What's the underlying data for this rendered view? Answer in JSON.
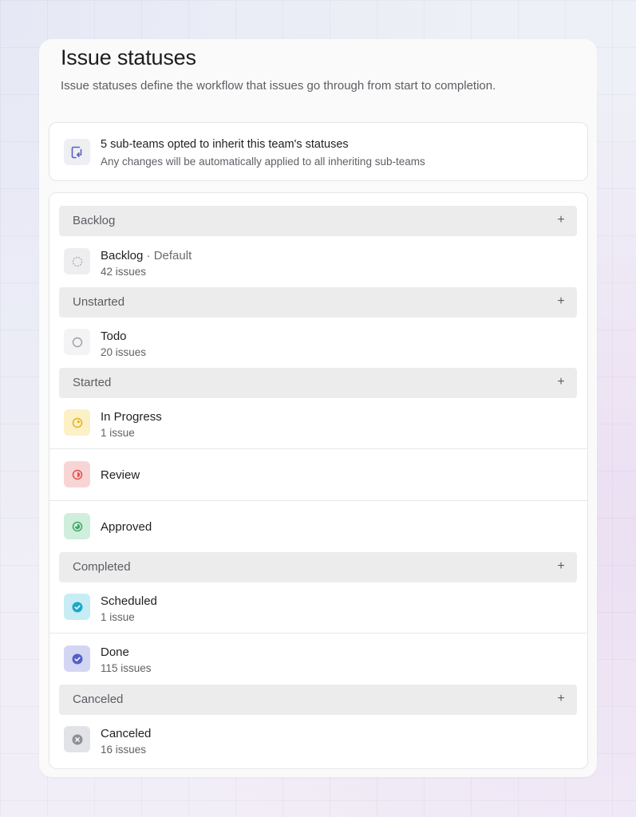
{
  "page": {
    "title": "Issue statuses",
    "subtitle": "Issue statuses define the workflow that issues go through from start to completion."
  },
  "info": {
    "icon": "inherit-arrow-icon",
    "title": "5 sub-teams opted to inherit this team's statuses",
    "subtitle": "Any changes will be automatically applied to all inheriting sub-teams"
  },
  "groups": {
    "backlog": {
      "label": "Backlog",
      "add": "+"
    },
    "unstarted": {
      "label": "Unstarted",
      "add": "+"
    },
    "started": {
      "label": "Started",
      "add": "+"
    },
    "completed": {
      "label": "Completed",
      "add": "+"
    },
    "canceled": {
      "label": "Canceled",
      "add": "+"
    }
  },
  "statuses": {
    "backlog": {
      "name": "Backlog",
      "default_tag": " · Default",
      "count": "42 issues",
      "icon": "dashed-circle-icon",
      "color": "#a9a9ad",
      "bg": "#eeeef0"
    },
    "todo": {
      "name": "Todo",
      "count": "20 issues",
      "icon": "empty-circle-icon",
      "color": "#9e9ea3",
      "bg": "#f3f3f5"
    },
    "in_progress": {
      "name": "In Progress",
      "count": "1 issue",
      "icon": "progress-circle-icon",
      "color": "#e3b41e",
      "bg": "#fbf0c6"
    },
    "review": {
      "name": "Review",
      "icon": "half-circle-icon",
      "color": "#e0514f",
      "bg": "#f8d5d5"
    },
    "approved": {
      "name": "Approved",
      "icon": "three-quarter-circle-icon",
      "color": "#3fa66a",
      "bg": "#cfeedc"
    },
    "scheduled": {
      "name": "Scheduled",
      "count": "1 issue",
      "icon": "check-circle-icon",
      "color": "#1aa9c9",
      "bg": "#c8ecf4"
    },
    "done": {
      "name": "Done",
      "count": "115 issues",
      "icon": "check-circle-icon",
      "color": "#5560c9",
      "bg": "#d3d6f3"
    },
    "canceled": {
      "name": "Canceled",
      "count": "16 issues",
      "icon": "x-circle-icon",
      "color": "#8d9098",
      "bg": "#e2e3e7"
    }
  }
}
